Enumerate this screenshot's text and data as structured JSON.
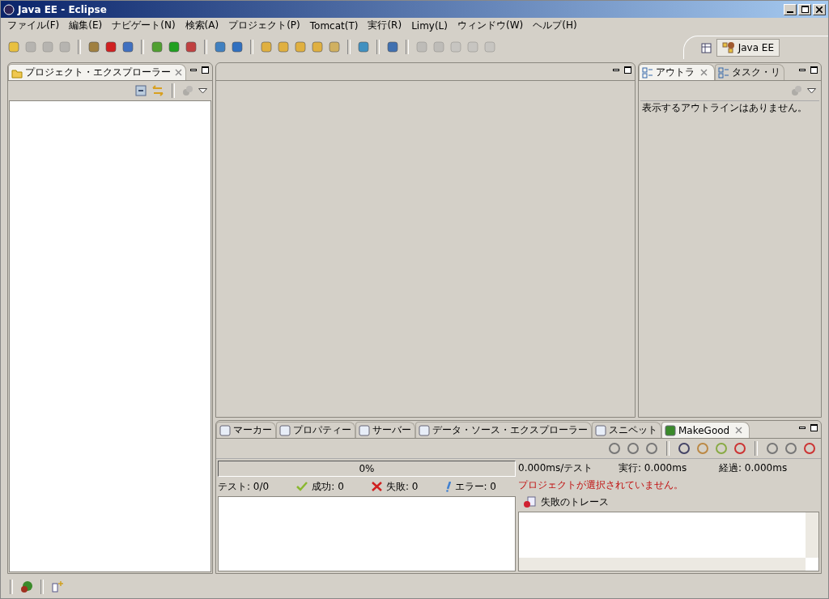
{
  "window": {
    "title": "Java EE - Eclipse"
  },
  "menu": [
    {
      "label": "ファイル(F)"
    },
    {
      "label": "編集(E)"
    },
    {
      "label": "ナビゲート(N)"
    },
    {
      "label": "検索(A)"
    },
    {
      "label": "プロジェクト(P)"
    },
    {
      "label": "Tomcat(T)"
    },
    {
      "label": "実行(R)"
    },
    {
      "label": "Limy(L)"
    },
    {
      "label": "ウィンドウ(W)"
    },
    {
      "label": "ヘルプ(H)"
    }
  ],
  "perspective": {
    "label": "Java EE",
    "selected": true
  },
  "project_explorer": {
    "tabs": [
      {
        "label": "プロジェクト・エクスプローラー",
        "selected": true
      }
    ]
  },
  "outline": {
    "tabs": [
      {
        "label": "アウトラ",
        "selected": true
      },
      {
        "label": "タスク・リ",
        "selected": false
      }
    ],
    "message": "表示するアウトラインはありません。"
  },
  "bottom": {
    "tabs": [
      {
        "label": "マーカー",
        "selected": false
      },
      {
        "label": "プロパティー",
        "selected": false
      },
      {
        "label": "サーバー",
        "selected": false
      },
      {
        "label": "データ・ソース・エクスプローラー",
        "selected": false
      },
      {
        "label": "スニペット",
        "selected": false
      },
      {
        "label": "MakeGood",
        "selected": true
      }
    ],
    "progress": {
      "level": 0,
      "label": "0%"
    },
    "time_per_test": "0.000ms/テスト",
    "run_time": "実行: 0.000ms",
    "elapsed": "経過: 0.000ms",
    "tests": "テスト: 0/0",
    "passed": "成功: 0",
    "failed": "失敗: 0",
    "errors": "エラー: 0",
    "message": "プロジェクトが選択されていません。",
    "failure_trace": "失敗のトレース"
  }
}
